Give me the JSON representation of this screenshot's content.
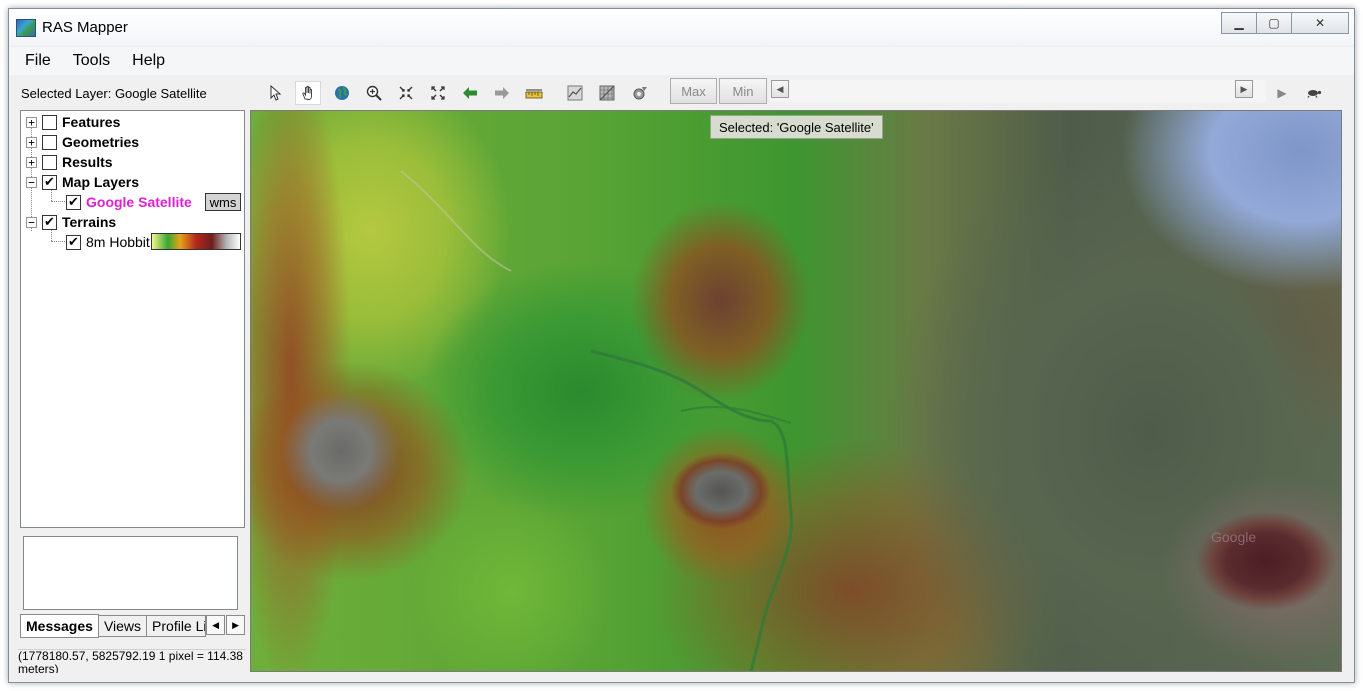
{
  "window": {
    "title": "RAS Mapper",
    "controls": {
      "minimize": "▁",
      "maximize": "▢",
      "close": "✕"
    }
  },
  "menubar": {
    "items": [
      "File",
      "Tools",
      "Help"
    ]
  },
  "selected_layer": "Selected Layer: Google Satellite",
  "toolbar": {
    "icons": [
      "pointer-icon",
      "pan-hand-icon",
      "globe-icon",
      "zoom-in-icon",
      "zoom-extent-icon",
      "full-extent-icon",
      "back-arrow-icon",
      "forward-arrow-icon",
      "measure-ruler-icon",
      "profile-plot-icon",
      "raster-grid-icon",
      "animation-settings-icon"
    ],
    "max_label": "Max",
    "min_label": "Min",
    "scroll_left": "◀",
    "scroll_right": "▶",
    "play": "▶",
    "turtle": "🐢"
  },
  "layers": {
    "features": "Features",
    "geometries": "Geometries",
    "results": "Results",
    "map_layers": "Map Layers",
    "google_satellite": "Google Satellite",
    "wms": "wms",
    "terrains": "Terrains",
    "terrain_item": "8m Hobbit"
  },
  "symbols": {
    "expand": "+",
    "collapse": "−",
    "check": "✔"
  },
  "tabs": {
    "messages": "Messages",
    "views": "Views",
    "profile": "Profile Lines",
    "left": "◀",
    "right": "▶"
  },
  "status": {
    "coords": "(1778180.57, 5825792.19  1 pixel = 114.38 meters)"
  },
  "map": {
    "tooltip": "Selected: 'Google Satellite'",
    "watermark": "Google",
    "accent": {
      "selected_layer": "#e020d0"
    }
  }
}
